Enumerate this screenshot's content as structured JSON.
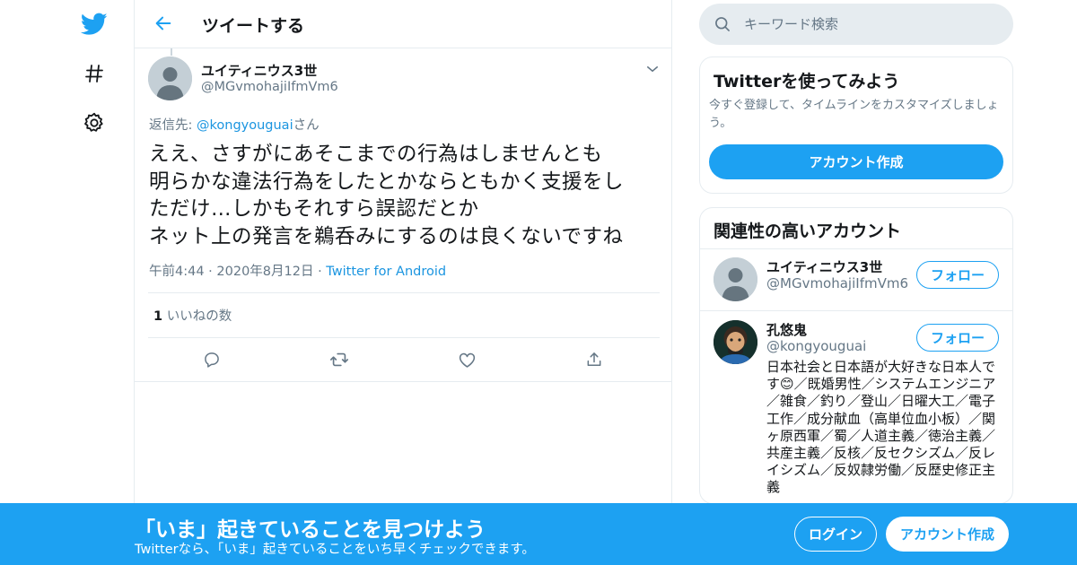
{
  "colors": {
    "brand": "#1da1f2",
    "link": "#1b95e0",
    "secondary_text": "#657786",
    "border": "#e6ecf0"
  },
  "nav": {
    "icons": [
      "twitter-bird-icon",
      "hashtag-icon",
      "gear-icon"
    ]
  },
  "header": {
    "title": "ツイートする"
  },
  "tweet": {
    "author_name": "ユイティニウス3世",
    "author_handle": "@MGvmohajiIfmVm6",
    "reply_prefix": "返信先: ",
    "reply_handle": "@kongyouguai",
    "reply_suffix": "さん",
    "text_lines": [
      "ええ、さすがにあそこまでの行為はしませんとも",
      "明らかな違法行為をしたとかならともかく支援をし",
      "ただけ…しかもそれすら誤認だとか",
      "ネット上の発言を鵜呑みにするのは良くないですね"
    ],
    "time": "午前4:44",
    "date": "2020年8月12日",
    "source": "Twitter for Android",
    "likes_count": "1",
    "likes_label": "いいねの数"
  },
  "search": {
    "placeholder": "キーワード検索"
  },
  "signup_card": {
    "title": "Twitterを使ってみよう",
    "description": "今すぐ登録して、タイムラインをカスタマイズしましょう。",
    "button": "アカウント作成"
  },
  "related": {
    "title": "関連性の高いアカウント",
    "accounts": [
      {
        "name": "ユイティニウス3世",
        "handle": "@MGvmohajiIfmVm6",
        "follow": "フォロー"
      },
      {
        "name": "孔悠鬼",
        "handle": "@kongyouguai",
        "follow": "フォロー",
        "bio": "日本社会と日本語が大好きな日本人です😊／既婚男性／システムエンジニア／雑食／釣り／登山／日曜大工／電子工作／成分献血（高単位血小板）／関ヶ原西軍／蜀／人道主義／徳治主義／共産主義／反核／反セクシズム／反レイシズム／反奴隷労働／反歴史修正主義"
      }
    ]
  },
  "bottom_bar": {
    "title": "「いま」起きていることを見つけよう",
    "subtitle": "Twitterなら、「いま」起きていることをいち早くチェックできます。",
    "login": "ログイン",
    "signup": "アカウント作成"
  }
}
